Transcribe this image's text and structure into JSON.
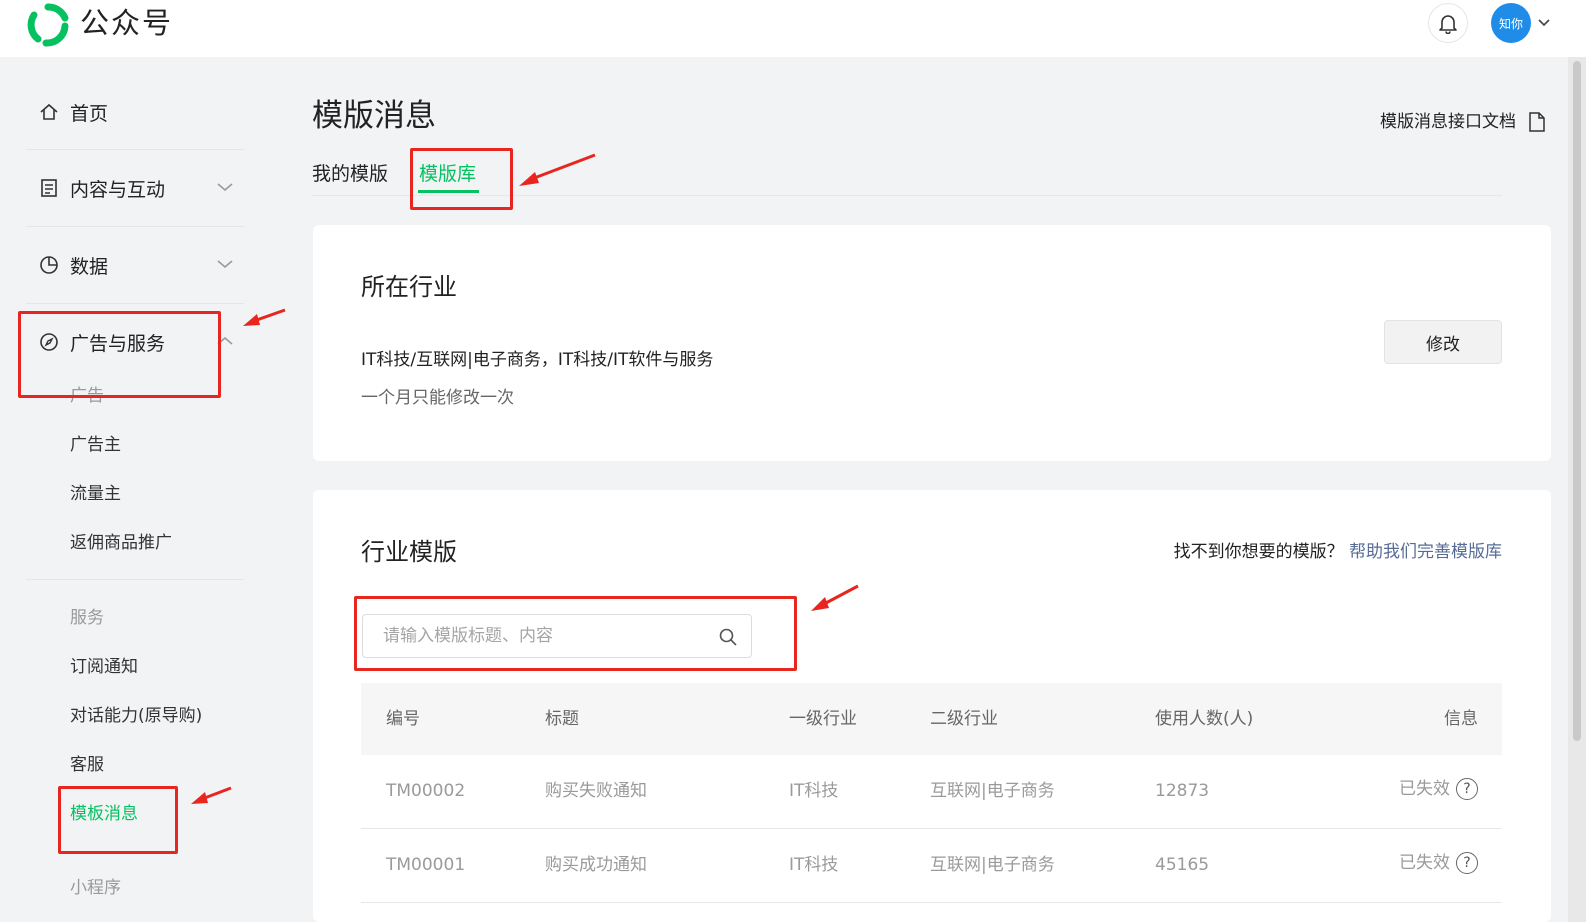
{
  "header": {
    "logo_text": "公众号",
    "avatar_text": "知你"
  },
  "sidebar": {
    "home": "首页",
    "content": "内容与互动",
    "data": "数据",
    "ads_services": "广告与服务",
    "group_ads": "广告",
    "advertiser": "广告主",
    "publisher": "流量主",
    "rebate": "返佣商品推广",
    "group_services": "服务",
    "subscribe_notice": "订阅通知",
    "dialog_ability": "对话能力(原导购)",
    "customer_service": "客服",
    "template_message": "模板消息",
    "group_miniprogram": "小程序"
  },
  "main": {
    "title": "模版消息",
    "doc_link": "模版消息接口文档",
    "tabs": [
      "我的模版",
      "模版库"
    ],
    "industry": {
      "title": "所在行业",
      "value": "IT科技/互联网|电子商务，IT科技/IT软件与服务",
      "note": "一个月只能修改一次",
      "modify_button": "修改"
    },
    "templates": {
      "title": "行业模版",
      "help_text": "找不到你想要的模版？",
      "help_link": "帮助我们完善模版库",
      "search_placeholder": "请输入模版标题、内容",
      "columns": [
        "编号",
        "标题",
        "一级行业",
        "二级行业",
        "使用人数(人)",
        "信息"
      ],
      "rows": [
        {
          "id": "TM00002",
          "title": "购买失败通知",
          "industry1": "IT科技",
          "industry2": "互联网|电子商务",
          "users": "12873",
          "status": "已失效"
        },
        {
          "id": "TM00001",
          "title": "购买成功通知",
          "industry1": "IT科技",
          "industry2": "互联网|电子商务",
          "users": "45165",
          "status": "已失效"
        }
      ]
    }
  },
  "colors": {
    "accent": "#07c160",
    "link": "#576b95",
    "annotation": "#e8261f",
    "avatar": "#1f8de8"
  }
}
